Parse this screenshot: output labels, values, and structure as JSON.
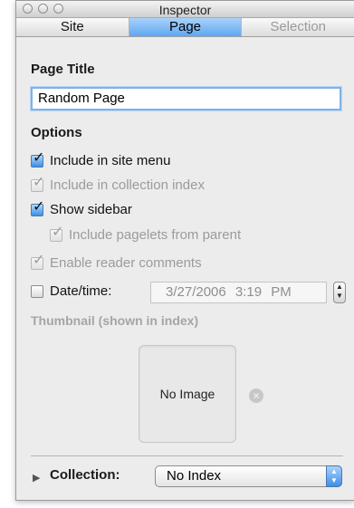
{
  "window": {
    "title": "Inspector"
  },
  "tabs": [
    {
      "label": "Site",
      "state": "normal"
    },
    {
      "label": "Page",
      "state": "selected"
    },
    {
      "label": "Selection",
      "state": "disabled"
    }
  ],
  "page_title": {
    "label": "Page Title",
    "value": "Random Page"
  },
  "options": {
    "heading": "Options",
    "include_site_menu": {
      "label": "Include in site menu",
      "checked": true,
      "enabled": true
    },
    "include_collection_index": {
      "label": "Include in collection index",
      "checked": true,
      "enabled": false
    },
    "show_sidebar": {
      "label": "Show sidebar",
      "checked": true,
      "enabled": true
    },
    "include_pagelets": {
      "label": "Include pagelets from parent",
      "checked": true,
      "enabled": false
    },
    "enable_comments": {
      "label": "Enable reader comments",
      "checked": true,
      "enabled": false
    },
    "datetime": {
      "label": "Date/time:",
      "checked": false,
      "date": "3/27/2006",
      "time": "3:19 PM"
    }
  },
  "thumbnail": {
    "label": "Thumbnail (shown in index)",
    "placeholder": "No Image"
  },
  "collection": {
    "label": "Collection:",
    "selected": "No Index"
  },
  "colors": {
    "accent": "#5fa7f1",
    "window_bg": "#ececec",
    "disabled_text": "#9b9b9b"
  }
}
